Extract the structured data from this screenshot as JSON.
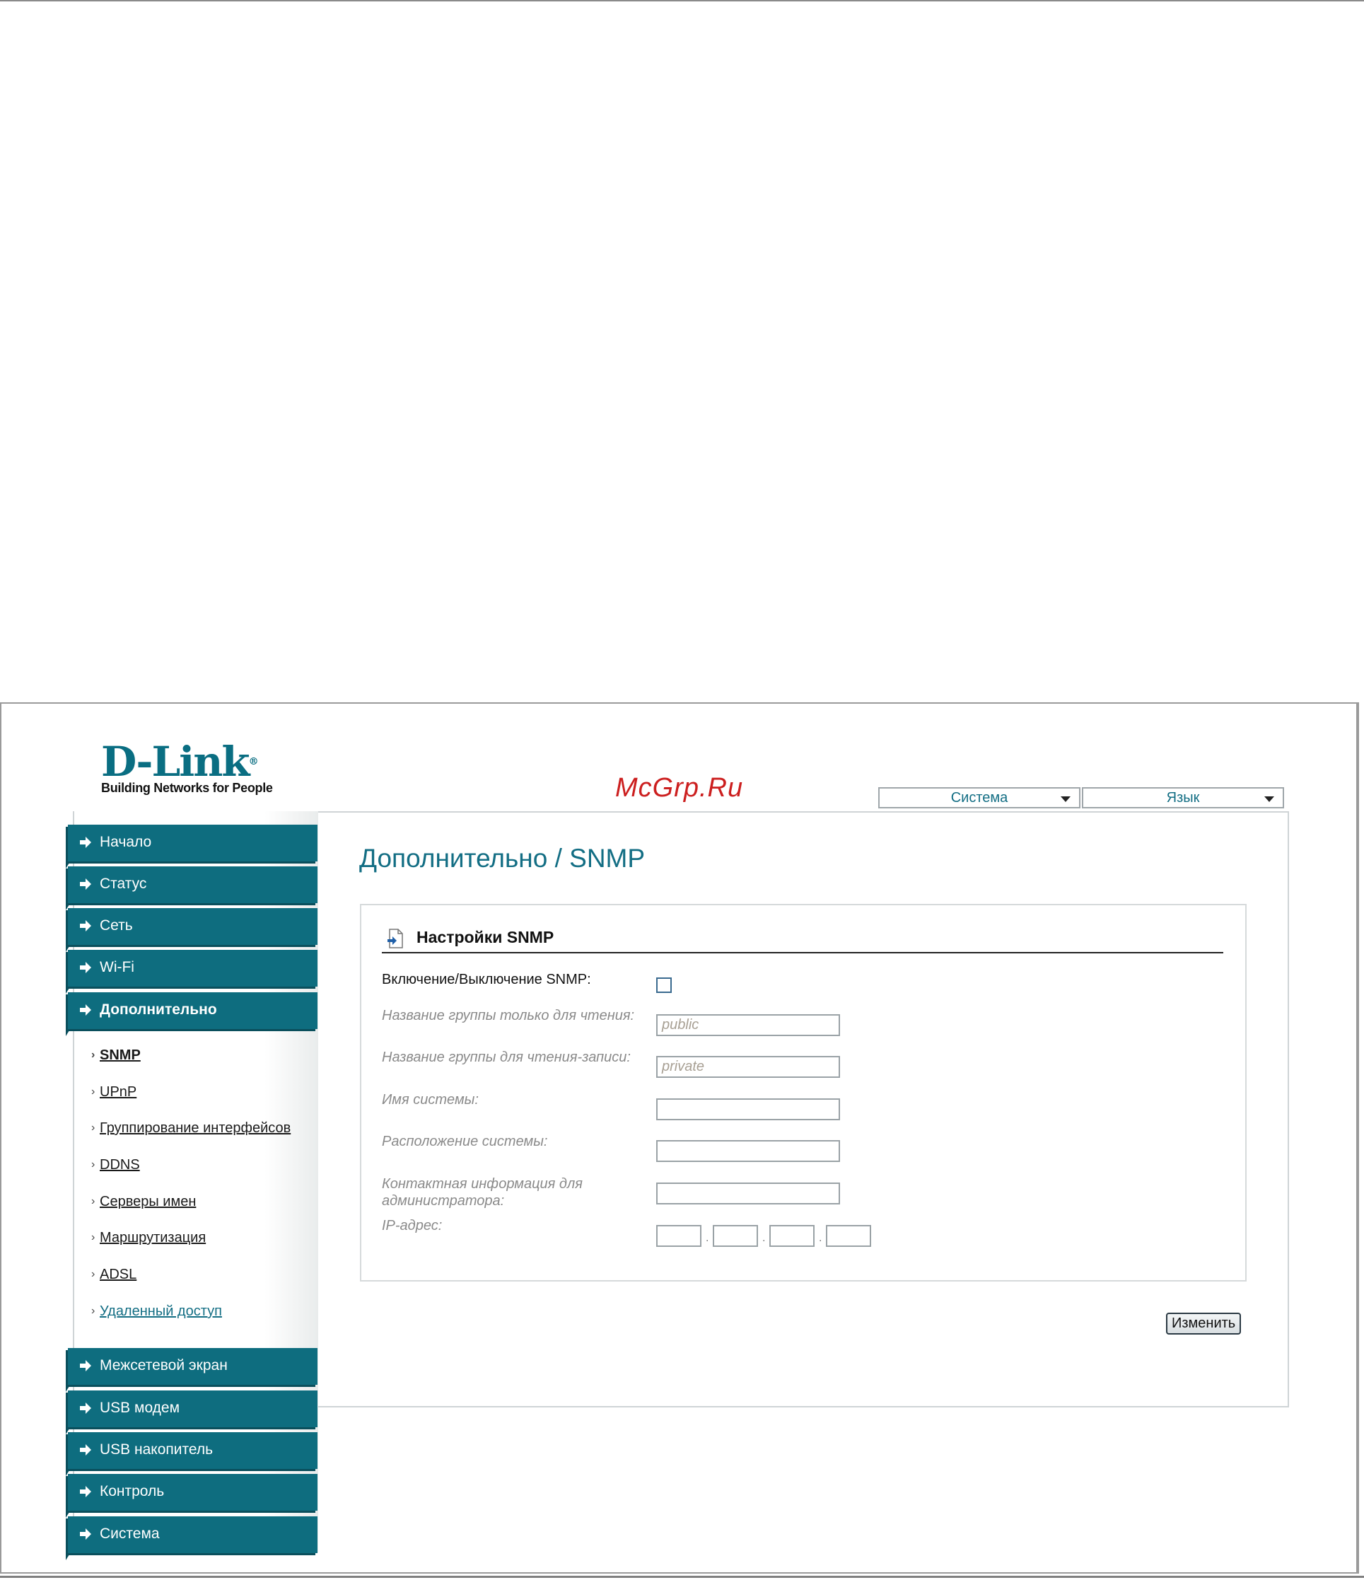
{
  "brand": {
    "logo_text": "D-Link",
    "logo_reg": "®",
    "tagline": "Building Networks for People"
  },
  "watermark": "McGrp.Ru",
  "top_menus": {
    "system_label": "Система",
    "language_label": "Язык"
  },
  "page": {
    "title": "Дополнительно /  SNMP"
  },
  "sidebar": {
    "items_top": [
      {
        "label": "Начало"
      },
      {
        "label": "Статус"
      },
      {
        "label": "Сеть"
      },
      {
        "label": "Wi-Fi"
      },
      {
        "label": "Дополнительно"
      }
    ],
    "subitems": [
      {
        "label": "SNMP"
      },
      {
        "label": "UPnP"
      },
      {
        "label": "Группирование интерфейсов"
      },
      {
        "label": "DDNS"
      },
      {
        "label": "Серверы имен"
      },
      {
        "label": "Маршрутизация"
      },
      {
        "label": "ADSL"
      },
      {
        "label": "Удаленный доступ"
      }
    ],
    "items_bottom": [
      {
        "label": "Межсетевой экран"
      },
      {
        "label": "USB модем"
      },
      {
        "label": "USB накопитель"
      },
      {
        "label": "Контроль"
      },
      {
        "label": "Система"
      }
    ]
  },
  "snmp": {
    "section_title": "Настройки SNMP",
    "enable_label": "Включение/Выключение SNMP:",
    "enabled": false,
    "ro_label": "Название группы только для чтения:",
    "ro_value": "public",
    "rw_label": "Название группы для чтения-записи:",
    "rw_value": "private",
    "sysname_label": "Имя системы:",
    "sysname_value": "",
    "location_label": "Расположение системы:",
    "location_value": "",
    "contact_label": "Контактная информация для администратора:",
    "contact_value": "",
    "ip_label": "IP-адрес:",
    "ip_separator": "."
  },
  "actions": {
    "change_label": "Изменить"
  },
  "colors": {
    "accent": "#136e84",
    "nav_bg": "#0e6d7f"
  }
}
